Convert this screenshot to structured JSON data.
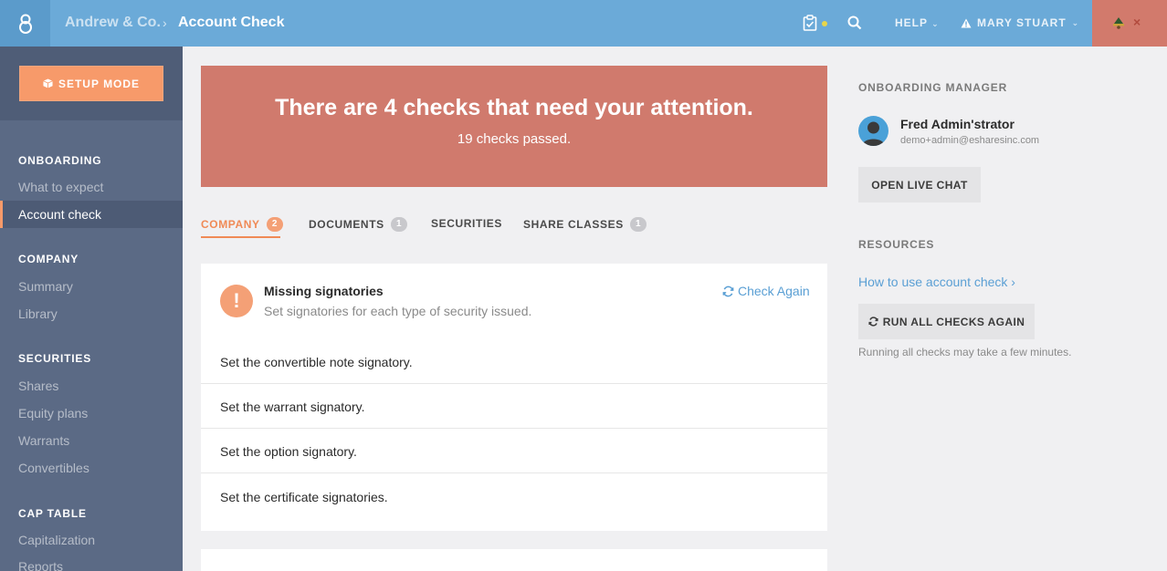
{
  "topbar": {
    "company": "Andrew & Co.",
    "separator": "›",
    "page_title": "Account Check",
    "help_label": "HELP",
    "user_label": "MARY STUART",
    "close_glyph": "×"
  },
  "sidebar": {
    "setup_label": "SETUP MODE",
    "sections": {
      "onboarding": "ONBOARDING",
      "company": "COMPANY",
      "securities": "SECURITIES",
      "cap_table": "CAP TABLE"
    },
    "items": {
      "what_to_expect": "What to expect",
      "account_check": "Account check",
      "summary": "Summary",
      "library": "Library",
      "shares": "Shares",
      "equity_plans": "Equity plans",
      "warrants": "Warrants",
      "convertibles": "Convertibles",
      "capitalization": "Capitalization",
      "reports": "Reports"
    }
  },
  "banner": {
    "title": "There are 4 checks that need your attention.",
    "subtitle": "19 checks passed."
  },
  "tabs": [
    {
      "label": "COMPANY",
      "badge": "2"
    },
    {
      "label": "DOCUMENTS",
      "badge": "1"
    },
    {
      "label": "SECURITIES",
      "badge": ""
    },
    {
      "label": "SHARE CLASSES",
      "badge": "1"
    }
  ],
  "check": {
    "icon_glyph": "!",
    "title": "Missing signatories",
    "subtitle": "Set signatories for each type of security issued.",
    "check_again": "Check Again",
    "items": [
      "Set the convertible note signatory.",
      "Set the warrant signatory.",
      "Set the option signatory.",
      "Set the certificate signatories."
    ]
  },
  "right": {
    "manager_heading": "ONBOARDING MANAGER",
    "manager_name": "Fred Admin'strator",
    "manager_email": "demo+admin@esharesinc.com",
    "live_chat": "OPEN LIVE CHAT",
    "resources_heading": "RESOURCES",
    "resource_link": "How to use account check ›",
    "run_all": "RUN ALL CHECKS AGAIN",
    "run_note": "Running all checks may take a few minutes."
  },
  "colors": {
    "topbar": "#6baad8",
    "sidebar": "#5b6a85",
    "accent": "#f79a6a",
    "banner": "#d07a6d",
    "link": "#5a9fd4"
  },
  "icons": [
    "logo-icon",
    "clipboard-icon",
    "search-icon",
    "warning-icon",
    "hat-icon",
    "close-icon",
    "cube-icon",
    "refresh-icon",
    "alert-icon",
    "avatar-icon"
  ]
}
